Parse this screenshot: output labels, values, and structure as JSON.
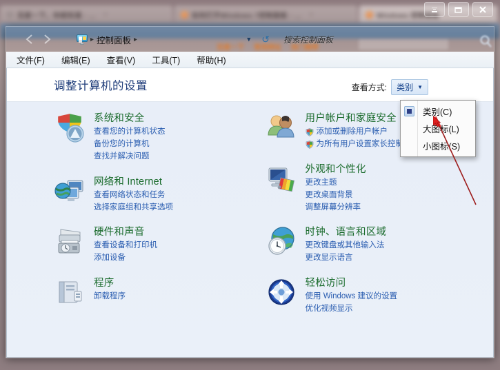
{
  "window": {
    "controls": [
      {
        "name": "minimize",
        "glyph": "minimize-icon"
      },
      {
        "name": "restore",
        "glyph": "restore-icon"
      },
      {
        "name": "close",
        "glyph": "close-icon",
        "label": "X"
      }
    ]
  },
  "background": {
    "tabs": [
      {
        "title": "百度一下，你就知道 - …",
        "favicon": "grey"
      },
      {
        "title": "如何打开Windows 7控制面板 - …",
        "favicon": "orange"
      },
      {
        "title": "Windows 控制面板",
        "favicon": "orange"
      }
    ],
    "bookmarks": [
      "百度一下",
      "常用网址",
      "热门推荐"
    ]
  },
  "navbar": {
    "back_label": "后退",
    "forward_label": "前进",
    "breadcrumb": {
      "icon": "control-panel-icon",
      "items": [
        "控制面板"
      ],
      "separator": "▸"
    },
    "dropdown_caret": "▼",
    "refresh_label": "刷新"
  },
  "search": {
    "placeholder": "搜索控制面板",
    "value": ""
  },
  "menubar": {
    "items": [
      {
        "label": "文件(F)"
      },
      {
        "label": "编辑(E)"
      },
      {
        "label": "查看(V)"
      },
      {
        "label": "工具(T)"
      },
      {
        "label": "帮助(H)"
      }
    ]
  },
  "page": {
    "title": "调整计算机的设置"
  },
  "viewby": {
    "label": "查看方式:",
    "value": "类别",
    "caret": "▼"
  },
  "viewby_menu": {
    "open": true,
    "items": [
      {
        "label": "类别(C)",
        "selected": true
      },
      {
        "label": "大图标(L)",
        "selected": false
      },
      {
        "label": "小图标(S)",
        "selected": false
      }
    ]
  },
  "categories": {
    "left": [
      {
        "icon": "security-shield-icon",
        "title": "系统和安全",
        "links": [
          {
            "label": "查看您的计算机状态",
            "shield": false
          },
          {
            "label": "备份您的计算机",
            "shield": false
          },
          {
            "label": "查找并解决问题",
            "shield": false
          }
        ]
      },
      {
        "icon": "network-icon",
        "title": "网络和 Internet",
        "links": [
          {
            "label": "查看网络状态和任务",
            "shield": false
          },
          {
            "label": "选择家庭组和共享选项",
            "shield": false
          }
        ]
      },
      {
        "icon": "hardware-printer-icon",
        "title": "硬件和声音",
        "links": [
          {
            "label": "查看设备和打印机",
            "shield": false
          },
          {
            "label": "添加设备",
            "shield": false
          }
        ]
      },
      {
        "icon": "programs-icon",
        "title": "程序",
        "links": [
          {
            "label": "卸载程序",
            "shield": false
          }
        ]
      }
    ],
    "right": [
      {
        "icon": "user-accounts-icon",
        "title": "用户帐户和家庭安全",
        "links": [
          {
            "label": "添加或删除用户帐户",
            "shield": true
          },
          {
            "label": "为所有用户设置家长控制",
            "shield": true
          }
        ]
      },
      {
        "icon": "appearance-icon",
        "title": "外观和个性化",
        "links": [
          {
            "label": "更改主题",
            "shield": false
          },
          {
            "label": "更改桌面背景",
            "shield": false
          },
          {
            "label": "调整屏幕分辨率",
            "shield": false
          }
        ]
      },
      {
        "icon": "clock-language-icon",
        "title": "时钟、语言和区域",
        "links": [
          {
            "label": "更改键盘或其他输入法",
            "shield": false
          },
          {
            "label": "更改显示语言",
            "shield": false
          }
        ]
      },
      {
        "icon": "ease-of-access-icon",
        "title": "轻松访问",
        "links": [
          {
            "label": "使用 Windows 建议的设置",
            "shield": false
          },
          {
            "label": "优化视频显示",
            "shield": false
          }
        ]
      }
    ]
  },
  "annotation": {
    "arrow_color": "#c00000",
    "cursor": "mouse-pointer"
  },
  "colors": {
    "category_title": "#1a6b2c",
    "link": "#2a5db0",
    "page_title": "#1f3d7a",
    "content_bg": "#e8eef8"
  }
}
